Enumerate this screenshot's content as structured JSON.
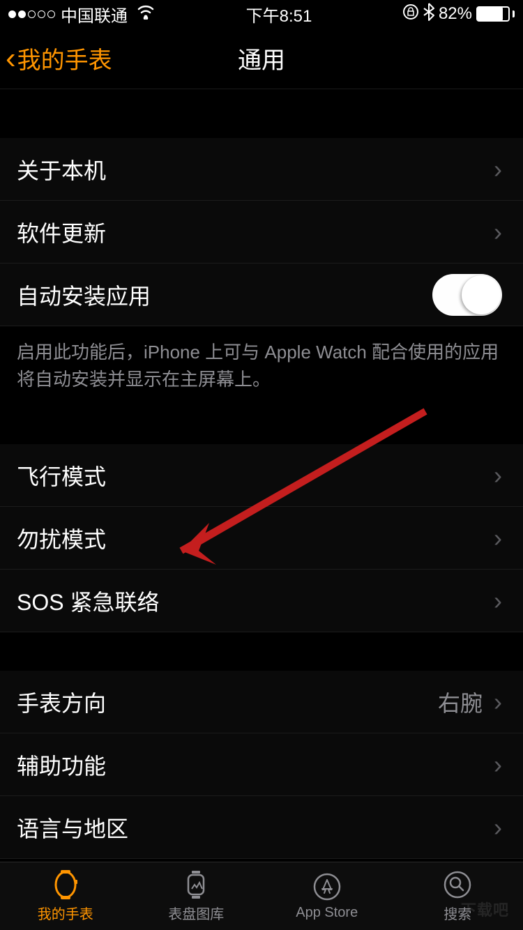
{
  "status": {
    "carrier": "中国联通",
    "time": "下午8:51",
    "battery_pct": "82%"
  },
  "nav": {
    "back": "我的手表",
    "title": "通用"
  },
  "section1": {
    "about": "关于本机",
    "software_update": "软件更新",
    "auto_install": "自动安装应用",
    "auto_install_on": true,
    "footer": "启用此功能后，iPhone 上可与 Apple Watch 配合使用的应用将自动安装并显示在主屏幕上。"
  },
  "section2": {
    "airplane": "飞行模式",
    "dnd": "勿扰模式",
    "sos": "SOS 紧急联络"
  },
  "section3": {
    "orientation": "手表方向",
    "orientation_value": "右腕",
    "accessibility": "辅助功能",
    "language": "语言与地区"
  },
  "tabs": {
    "my_watch": "我的手表",
    "face_gallery": "表盘图库",
    "app_store": "App Store",
    "search": "搜索"
  },
  "watermark": "下载吧"
}
